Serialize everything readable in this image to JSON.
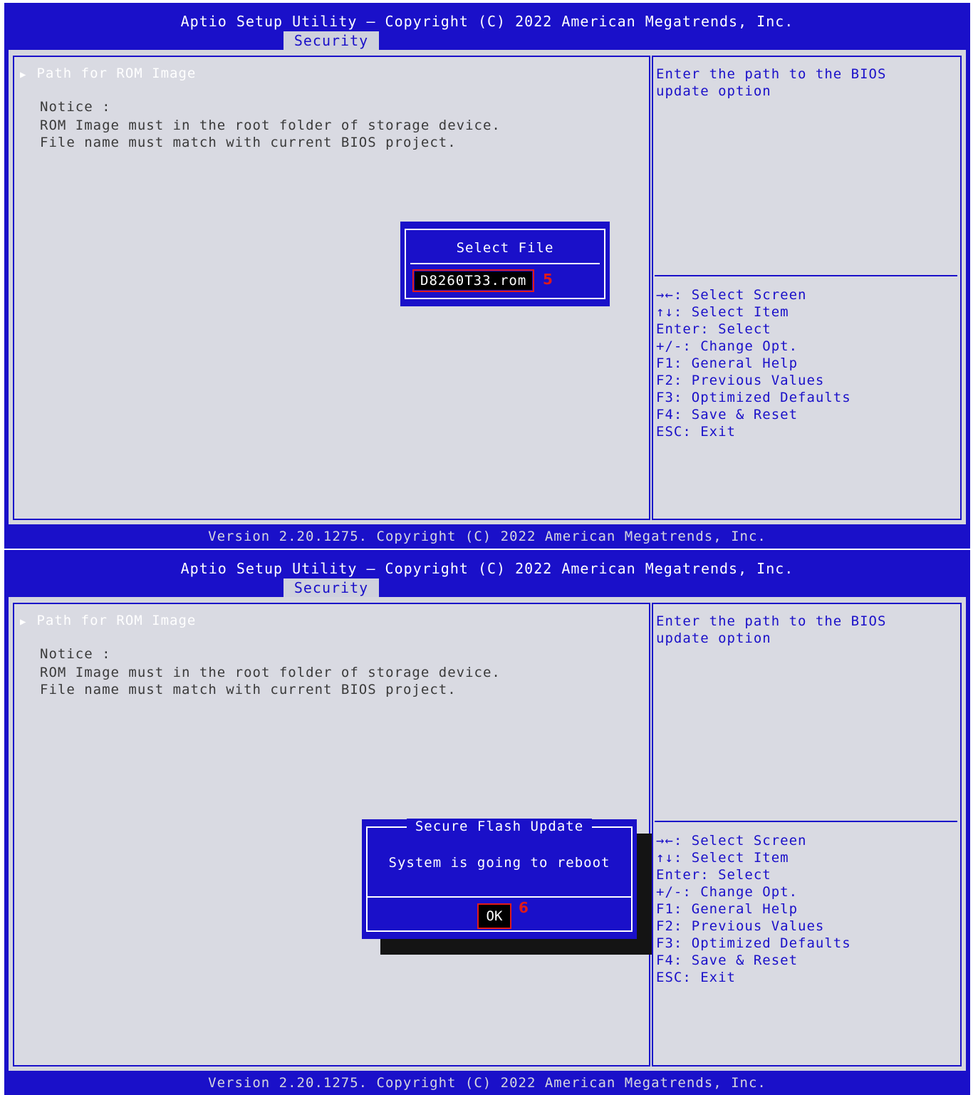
{
  "screens": [
    {
      "title": "Aptio Setup Utility – Copyright (C) 2022 American Megatrends, Inc.",
      "tab": "Security",
      "menu_item": "Path for ROM Image",
      "notice": [
        "Notice :",
        "ROM Image must in the root folder of storage device.",
        "File name must match with current BIOS project."
      ],
      "help": "Enter the path to the BIOS\nupdate option",
      "keys": [
        "→←: Select Screen",
        "↑↓: Select Item",
        "Enter: Select",
        "+/-: Change Opt.",
        "F1: General Help",
        "F2: Previous Values",
        "F3: Optimized Defaults",
        "F4: Save & Reset",
        "ESC: Exit"
      ],
      "footer": "Version 2.20.1275. Copyright (C) 2022 American Megatrends, Inc.",
      "dialog": {
        "title": "Select File",
        "file": "D8260T33.rom",
        "step_marker": "5"
      }
    },
    {
      "title": "Aptio Setup Utility – Copyright (C) 2022 American Megatrends, Inc.",
      "tab": "Security",
      "menu_item": "Path for ROM Image",
      "notice": [
        "Notice :",
        "ROM Image must in the root folder of storage device.",
        "File name must match with current BIOS project."
      ],
      "help": "Enter the path to the BIOS\nupdate option",
      "keys": [
        "→←: Select Screen",
        "↑↓: Select Item",
        "Enter: Select",
        "+/-: Change Opt.",
        "F1: General Help",
        "F2: Previous Values",
        "F3: Optimized Defaults",
        "F4: Save & Reset",
        "ESC: Exit"
      ],
      "footer": "Version 2.20.1275. Copyright (C) 2022 American Megatrends, Inc.",
      "dialog": {
        "title": "Secure Flash Update",
        "message": "System is going to reboot",
        "button": "OK",
        "step_marker": "6"
      }
    }
  ],
  "colors": {
    "bios_blue": "#1a10c9",
    "panel_gray": "#d9dae2",
    "marker_red": "#e01a1a"
  },
  "icons": {
    "menu_arrow": "triangle-right-icon"
  }
}
